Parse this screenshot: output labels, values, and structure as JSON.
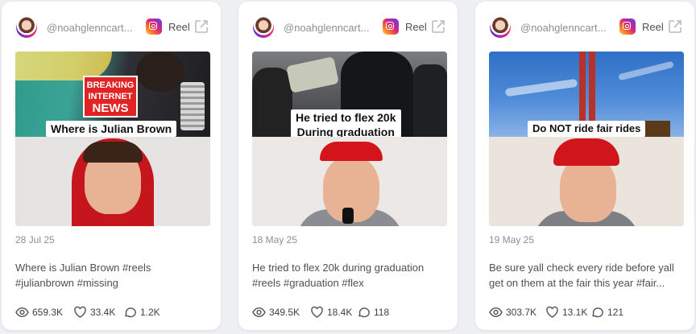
{
  "colors": {
    "accent_red": "#e02424",
    "text_muted": "#8b8f96"
  },
  "cards": [
    {
      "handle": "@noahglenncart...",
      "type_label": "Reel",
      "overlay_caption": "Where is Julian Brown",
      "news_badge": [
        "BREAKING",
        "INTERNET",
        "NEWS"
      ],
      "date": "28 Jul 25",
      "desc_lines": [
        "Where is Julian Brown #reels",
        "#julianbrown #missing"
      ],
      "views": "659.3K",
      "likes": "33.4K",
      "comments": "1.2K"
    },
    {
      "handle": "@noahglenncart...",
      "type_label": "Reel",
      "overlay_caption_lines": [
        "He tried to flex 20k",
        "During graduation"
      ],
      "date": "18 May 25",
      "desc_lines": [
        "He tried to flex 20k during graduation",
        "#reels #graduation #flex"
      ],
      "views": "349.5K",
      "likes": "18.4K",
      "comments": "118"
    },
    {
      "handle": "@noahglenncart...",
      "type_label": "Reel",
      "overlay_caption": "Do NOT ride fair rides",
      "date": "19 May 25",
      "desc_lines": [
        "Be sure yall check every ride before yall",
        "get on them at the fair this year #fair..."
      ],
      "views": "303.7K",
      "likes": "13.1K",
      "comments": "121"
    }
  ],
  "icons": [
    "instagram-avatar",
    "instagram-icon",
    "external-link-icon",
    "eye-icon",
    "heart-icon",
    "comment-icon"
  ]
}
